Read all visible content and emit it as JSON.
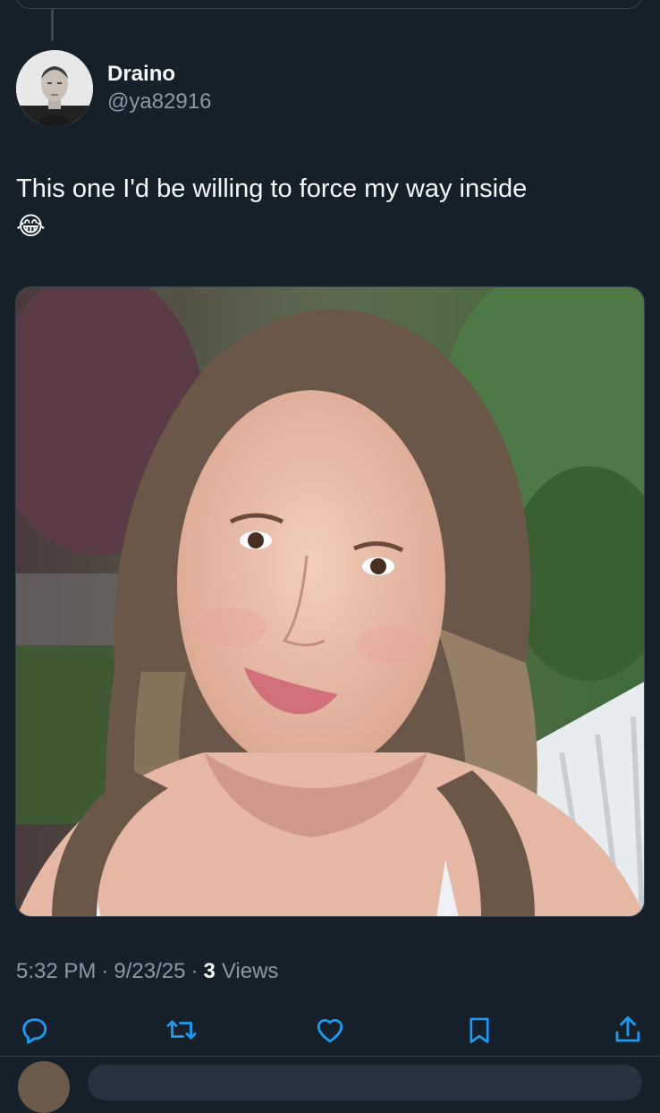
{
  "tweet": {
    "author": {
      "display_name": "Draino",
      "handle": "@ya82916",
      "avatar_icon": "avatar-photo-icon"
    },
    "text": "This one I'd be willing to force my way inside",
    "emoji": "😂",
    "media": {
      "icon": "photo-image-icon"
    },
    "meta": {
      "time": "5:32 PM",
      "separator": "·",
      "date": "9/23/25",
      "views_count": "3",
      "views_label": "Views"
    },
    "actions": [
      {
        "name": "reply",
        "icon": "reply-icon"
      },
      {
        "name": "retweet",
        "icon": "retweet-icon"
      },
      {
        "name": "like",
        "icon": "heart-icon"
      },
      {
        "name": "bookmark",
        "icon": "bookmark-icon"
      },
      {
        "name": "share",
        "icon": "share-icon"
      }
    ]
  },
  "colors": {
    "background": "#15202b",
    "text_primary": "#f7f9f9",
    "text_secondary": "#8b98a5",
    "icon": "#1d9bf0",
    "border": "#38444d"
  }
}
